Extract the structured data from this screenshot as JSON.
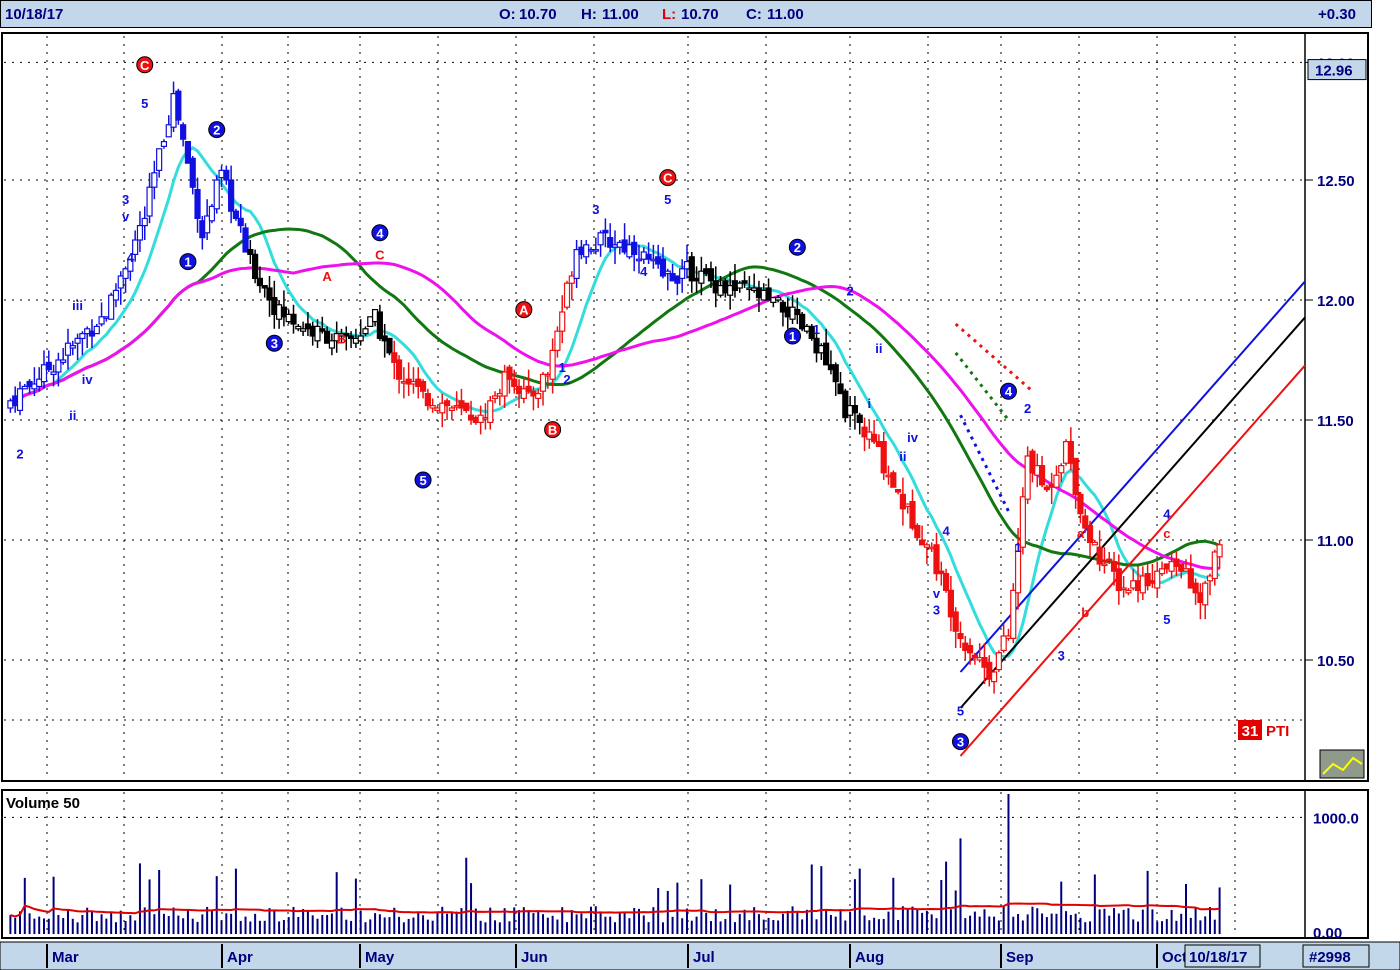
{
  "header": {
    "date": "10/18/17",
    "open_label": "O:",
    "open": "10.70",
    "high_label": "H:",
    "high": "11.00",
    "low_label": "L:",
    "low": "10.70",
    "close_label": "C:",
    "close": "11.00",
    "change": "+0.30"
  },
  "colors": {
    "up_bar": "#ffffff",
    "blue_trend": "#1010e0",
    "red_trend": "#ee1111",
    "neutral_trend": "#000000",
    "ma_fast": "#33dddd",
    "ma_mid": "#117711",
    "ma_slow": "#ee11ee",
    "volume_bar": "#00007f",
    "volume_ma": "#e00000",
    "grid": "#000000"
  },
  "price_axis": {
    "min": 10.0,
    "max": 13.1,
    "ticks": [
      "12.00",
      "12.50",
      "12.00",
      "11.50",
      "11.00",
      "10.50"
    ],
    "tick_values": [
      12.99,
      12.5,
      12.0,
      11.5,
      11.0,
      10.5
    ],
    "last_price": "12.96"
  },
  "volume_panel": {
    "title": "Volume 50",
    "ticks": [
      "1000.0",
      "0.00"
    ],
    "tick_values": [
      1000,
      0
    ],
    "max": 1200
  },
  "x_axis": {
    "months": [
      "Mar",
      "Apr",
      "May",
      "Jun",
      "Jul",
      "Aug",
      "Sep",
      "Oct"
    ],
    "current_date": "10/18/17"
  },
  "chart_number": "#2998",
  "pti": {
    "value": "31",
    "label": "PTI"
  },
  "chart_data": {
    "type": "candlestick",
    "x_unit": "trading bar index (0 = first bar shown)",
    "bars": [],
    "volume": [],
    "moving_averages": [],
    "trendlines": [],
    "wave_labels": []
  }
}
